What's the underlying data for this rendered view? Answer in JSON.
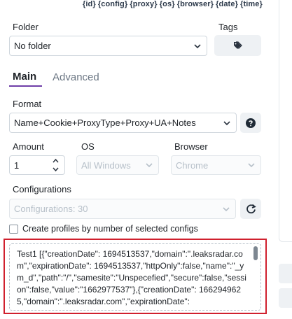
{
  "variables": "{id} {config} {proxy} {os} {browser} {date} {time}",
  "folder": {
    "label": "Folder",
    "value": "No folder"
  },
  "tags": {
    "label": "Tags",
    "icon": "tag-icon"
  },
  "tabs": [
    {
      "label": "Main",
      "active": true
    },
    {
      "label": "Advanced",
      "active": false
    }
  ],
  "format": {
    "label": "Format",
    "value": "Name+Cookie+ProxyType+Proxy+UA+Notes",
    "help_icon": "question-icon"
  },
  "amount": {
    "label": "Amount",
    "value": "1"
  },
  "os": {
    "label": "OS",
    "value": "All Windows"
  },
  "browser": {
    "label": "Browser",
    "value": "Chrome"
  },
  "configurations": {
    "label": "Configurations",
    "value": "Configurations: 30",
    "refresh_icon": "refresh-icon"
  },
  "create_by_configs": {
    "label": "Create profiles by number of selected configs",
    "checked": false
  },
  "textarea": {
    "value": "Test1            [{\"creationDate\": 1694513537,\"domain\":\".leaksradar.com\",\"expirationDate\": 1694513537,\"httpOnly\":false,\"name\":\"_ym_d\",\"path\":\"/\",\"samesite\":\"Unspecefied\",\"secure\":false,\"session\":false,\"value\":\"1662977537\"},{\"creationDate\": 1662949625,\"domain\":\".leaksradar.com\",\"expirationDate\":"
  },
  "colors": {
    "accent": "#6f3ea8",
    "highlight_border": "#d0202e",
    "disabled_text": "#b7c0c9"
  }
}
